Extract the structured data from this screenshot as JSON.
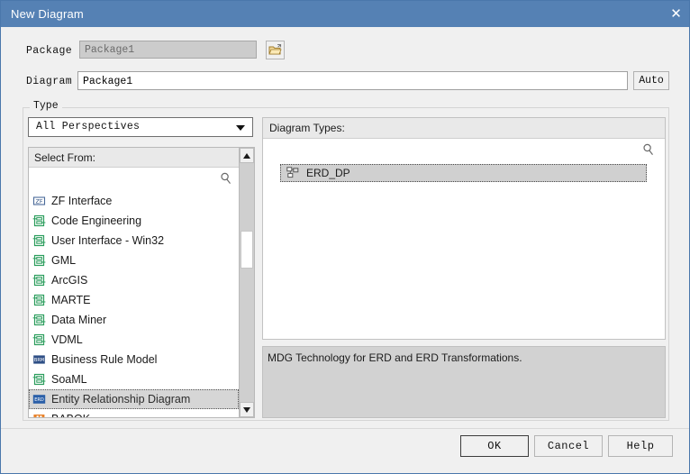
{
  "window": {
    "title": "New Diagram",
    "close_icon": "close-icon"
  },
  "package": {
    "label": "Package",
    "value": "Package1",
    "browse_icon": "folder-open-icon"
  },
  "diagram": {
    "label": "Diagram",
    "value": "Package1",
    "auto_label": "Auto"
  },
  "type_group": {
    "label": "Type",
    "perspective": {
      "selected": "All Perspectives",
      "dropdown_icon": "chevron-down-icon"
    },
    "select_from": {
      "header": "Select From:",
      "search_icon": "search-icon",
      "items": [
        {
          "label": "ZF Interface",
          "icon": "zf-interface-icon",
          "selected": false
        },
        {
          "label": "Code Engineering",
          "icon": "profile-icon",
          "selected": false
        },
        {
          "label": "User Interface - Win32",
          "icon": "profile-icon",
          "selected": false
        },
        {
          "label": "GML",
          "icon": "profile-icon",
          "selected": false
        },
        {
          "label": "ArcGIS",
          "icon": "profile-icon",
          "selected": false
        },
        {
          "label": "MARTE",
          "icon": "profile-icon",
          "selected": false
        },
        {
          "label": "Data Miner",
          "icon": "profile-icon",
          "selected": false
        },
        {
          "label": "VDML",
          "icon": "profile-icon",
          "selected": false
        },
        {
          "label": "Business Rule Model",
          "icon": "brm-icon",
          "selected": false
        },
        {
          "label": "SoaML",
          "icon": "profile-icon",
          "selected": false
        },
        {
          "label": "Entity Relationship Diagram",
          "icon": "erd-icon",
          "selected": true
        },
        {
          "label": "BABOK",
          "icon": "babok-icon",
          "selected": false
        }
      ],
      "scrollbar": {
        "up_icon": "scroll-up-icon",
        "down_icon": "scroll-down-icon",
        "thumb": "scrollbar-thumb"
      }
    },
    "diagram_types": {
      "header": "Diagram Types:",
      "search_icon": "search-icon",
      "items": [
        {
          "label": "ERD_DP",
          "icon": "diagram-icon",
          "selected": true
        }
      ]
    },
    "description": "MDG Technology for ERD and ERD Transformations."
  },
  "footer": {
    "ok_label": "OK",
    "cancel_label": "Cancel",
    "help_label": "Help"
  },
  "colors": {
    "titlebar": "#5581b4",
    "dialog_bg": "#f0f0f0",
    "selection": "#d6d6d6",
    "description_bg": "#d2d2d2",
    "profile_icon_green": "#2a9d5c",
    "erd_icon_blue": "#2a5fa8",
    "babok_icon_orange": "#e8822a"
  }
}
